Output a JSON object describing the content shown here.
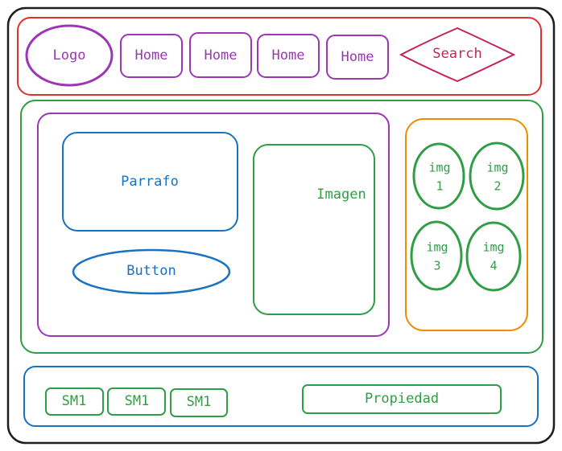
{
  "colors": {
    "frame": "#1e1e1e",
    "header": "#e03131",
    "nav": "#9c36b5",
    "search": "#c2255c",
    "main": "#2f9e44",
    "article": "#9c36b5",
    "text_block": "#1971c2",
    "image_block": "#2f9e44",
    "gallery": "#f08c00",
    "footer": "#1971c2",
    "footer_items": "#2f9e44"
  },
  "header": {
    "logo": "Logo",
    "nav_items": [
      "Home",
      "Home",
      "Home",
      "Home"
    ],
    "search": "Search"
  },
  "content": {
    "paragraph": "Parrafo",
    "button": "Button",
    "image": "Imagen"
  },
  "gallery": {
    "items": [
      {
        "line1": "img",
        "line2": "1"
      },
      {
        "line1": "img",
        "line2": "2"
      },
      {
        "line1": "img",
        "line2": "3"
      },
      {
        "line1": "img",
        "line2": "4"
      }
    ]
  },
  "footer": {
    "social": [
      "SM1",
      "SM1",
      "SM1"
    ],
    "property": "Propiedad"
  }
}
